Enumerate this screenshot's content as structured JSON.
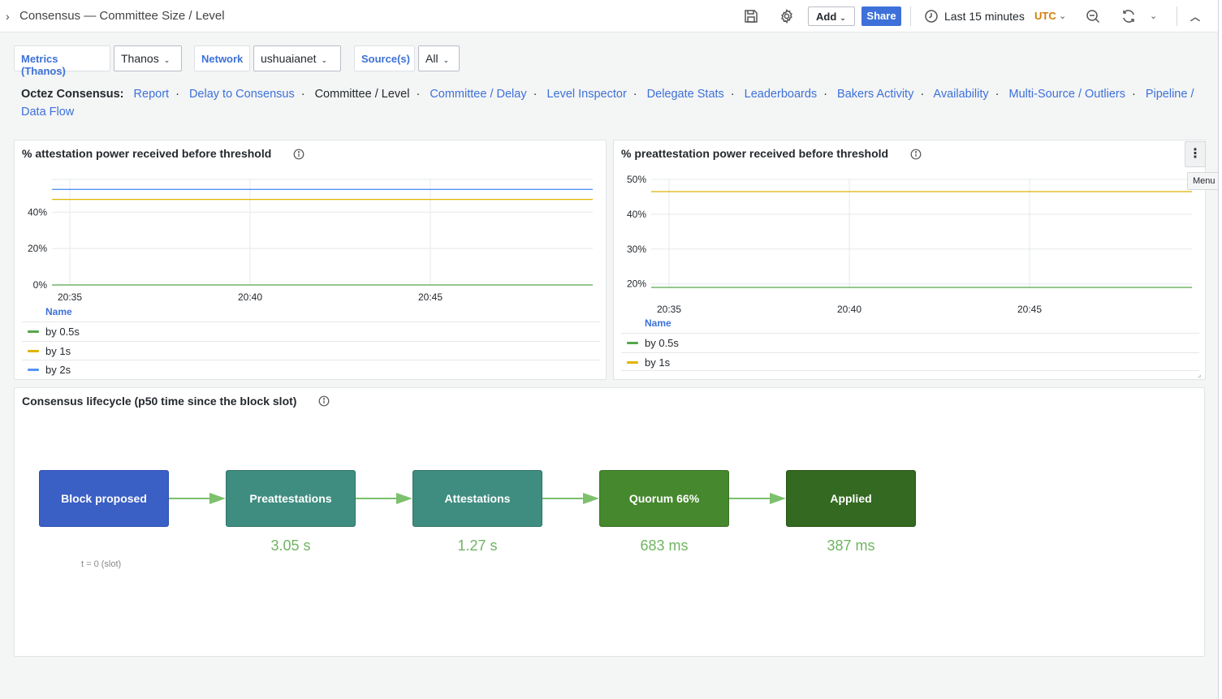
{
  "header": {
    "title": "Consensus — Committee Size / Level",
    "add_label": "Add",
    "share_label": "Share",
    "time_range": "Last 15 minutes",
    "timezone": "UTC"
  },
  "variables": [
    {
      "label": "Metrics (Thanos)",
      "value": "Thanos"
    },
    {
      "label": "Network",
      "value": "ushuaianet"
    },
    {
      "label": "Source(s)",
      "value": "All"
    }
  ],
  "nav": {
    "prefix": "Octez Consensus:",
    "links": [
      {
        "label": "Report",
        "current": false
      },
      {
        "label": "Delay to Consensus",
        "current": false
      },
      {
        "label": "Committee / Level",
        "current": true
      },
      {
        "label": "Committee / Delay",
        "current": false
      },
      {
        "label": "Level Inspector",
        "current": false
      },
      {
        "label": "Delegate Stats",
        "current": false
      },
      {
        "label": "Leaderboards",
        "current": false
      },
      {
        "label": "Bakers Activity",
        "current": false
      },
      {
        "label": "Availability",
        "current": false
      },
      {
        "label": "Multi-Source / Outliers",
        "current": false
      },
      {
        "label": "Pipeline / Data Flow",
        "current": false
      }
    ]
  },
  "panel_attestation": {
    "title": "% attestation power received before threshold",
    "legend_header": "Name",
    "legend": [
      "by 0.5s",
      "by 1s",
      "by 2s"
    ]
  },
  "panel_preattestation": {
    "title": "% preattestation power received before threshold",
    "legend_header": "Name",
    "legend": [
      "by 0.5s",
      "by 1s"
    ],
    "menu_tooltip": "Menu"
  },
  "lifecycle": {
    "title": "Consensus lifecycle (p50 time since the block slot)",
    "stages": [
      {
        "label": "Block proposed",
        "value": "",
        "color": "#3a5fc5"
      },
      {
        "label": "Preattestations",
        "value": "3.05 s",
        "color": "#3f8d80"
      },
      {
        "label": "Attestations",
        "value": "1.27 s",
        "color": "#3f8d80"
      },
      {
        "label": "Quorum 66%",
        "value": "683 ms",
        "color": "#46882d"
      },
      {
        "label": "Applied",
        "value": "387 ms",
        "color": "#336920"
      }
    ],
    "slot_note": "t = 0 (slot)"
  },
  "chart_data": [
    {
      "type": "line",
      "title": "% attestation power received before threshold",
      "x_ticks": [
        "20:35",
        "20:40",
        "20:45"
      ],
      "y_ticks": [
        "0%",
        "20%",
        "40%"
      ],
      "ylim": [
        0,
        58
      ],
      "x_domain": [
        0,
        15
      ],
      "grid": true,
      "legend_placement": "bottom",
      "series": [
        {
          "name": "by 0.5s",
          "color": "#56a64b",
          "x": [
            0,
            15
          ],
          "y": [
            0,
            0
          ]
        },
        {
          "name": "by 1s",
          "color": "#e0b400",
          "x": [
            0,
            15
          ],
          "y": [
            47,
            47
          ]
        },
        {
          "name": "by 2s",
          "color": "#5794f2",
          "x": [
            0,
            15
          ],
          "y": [
            52.5,
            52.5
          ]
        }
      ]
    },
    {
      "type": "line",
      "title": "% preattestation power received before threshold",
      "x_ticks": [
        "20:35",
        "20:40",
        "20:45"
      ],
      "y_ticks": [
        "20%",
        "30%",
        "40%",
        "50%"
      ],
      "ylim": [
        19,
        50
      ],
      "x_domain": [
        0,
        15
      ],
      "grid": true,
      "legend_placement": "bottom",
      "series": [
        {
          "name": "by 0.5s",
          "color": "#56a64b",
          "x": [
            0,
            15
          ],
          "y": [
            19,
            19
          ]
        },
        {
          "name": "by 1s",
          "color": "#e0b400",
          "x": [
            0,
            15
          ],
          "y": [
            46.5,
            46.5
          ]
        }
      ]
    }
  ]
}
